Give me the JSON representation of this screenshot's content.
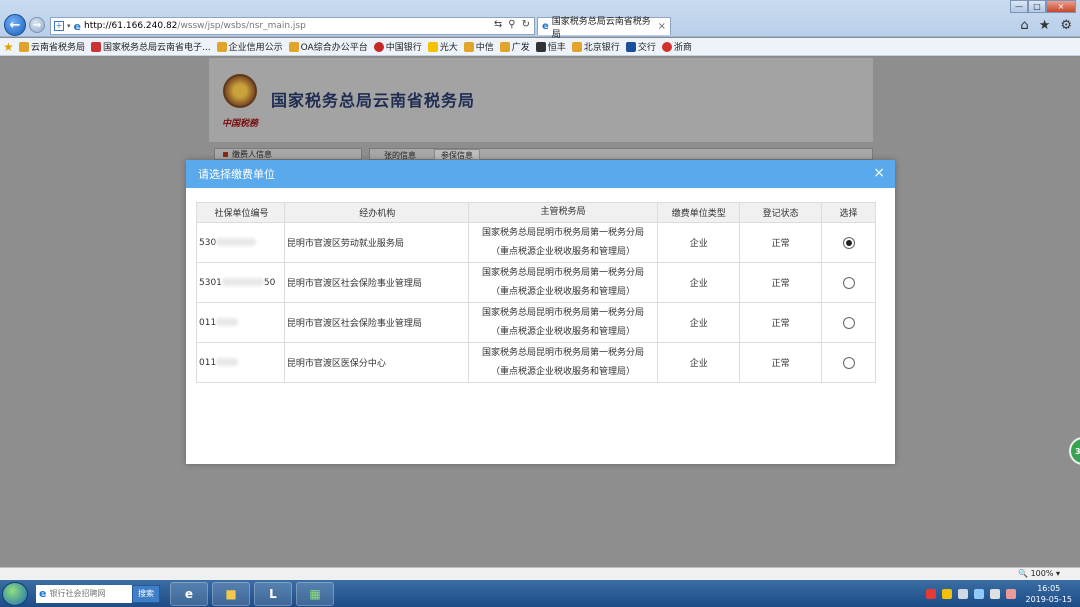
{
  "browser": {
    "address_host": "http://61.166.240.82",
    "address_path": "/wssw/jsp/wsbs/nsr_main.jsp",
    "tab_title": "国家税务总局云南省税务局",
    "zoom_level": "100%"
  },
  "favorites": [
    {
      "label": "云南省税务局",
      "icon_color": "#e0a42a"
    },
    {
      "label": "国家税务总局云南省电子...",
      "icon_color": "#c33"
    },
    {
      "label": "企业信用公示",
      "icon_color": "#e0a42a"
    },
    {
      "label": "OA综合办公平台",
      "icon_color": "#e0a42a"
    },
    {
      "label": "中国银行",
      "icon_color": "#c62828"
    },
    {
      "label": "光大",
      "icon_color": "#f2c200"
    },
    {
      "label": "中信",
      "icon_color": "#e0a42a"
    },
    {
      "label": "广发",
      "icon_color": "#e0a42a"
    },
    {
      "label": "恒丰",
      "icon_color": "#333"
    },
    {
      "label": "北京银行",
      "icon_color": "#e0a42a"
    },
    {
      "label": "交行",
      "icon_color": "#1a4f9c"
    },
    {
      "label": "浙商",
      "icon_color": "#d32f2f"
    }
  ],
  "page": {
    "title": "国家税务总局云南省税务局",
    "slogan": "中国税務",
    "panel_left": "缴费人信息",
    "panel_right_1": "张的信息",
    "panel_right_2": "参保信息",
    "side_badge": "37"
  },
  "modal": {
    "title": "请选择缴费单位",
    "columns": [
      "社保单位编号",
      "经办机构",
      "主管税务局",
      "缴费单位类型",
      "登记状态",
      "选择"
    ],
    "rows": [
      {
        "code_prefix": "530",
        "code_suffix": "",
        "agency": "昆明市官渡区劳动就业服务局",
        "tax_office_line1": "国家税务总局昆明市税务局第一税务分局",
        "tax_office_line2": "（重点税源企业税收服务和管理局）",
        "type": "企业",
        "status": "正常",
        "selected": true
      },
      {
        "code_prefix": "5301",
        "code_suffix": "50",
        "agency": "昆明市官渡区社会保险事业管理局",
        "tax_office_line1": "国家税务总局昆明市税务局第一税务分局",
        "tax_office_line2": "（重点税源企业税收服务和管理局）",
        "type": "企业",
        "status": "正常",
        "selected": false
      },
      {
        "code_prefix": "011",
        "code_suffix": "",
        "agency": "昆明市官渡区社会保险事业管理局",
        "tax_office_line1": "国家税务总局昆明市税务局第一税务分局",
        "tax_office_line2": "（重点税源企业税收服务和管理局）",
        "type": "企业",
        "status": "正常",
        "selected": false
      },
      {
        "code_prefix": "011",
        "code_suffix": "",
        "agency": "昆明市官渡区医保分中心",
        "tax_office_line1": "国家税务总局昆明市税务局第一税务分局",
        "tax_office_line2": "（重点税源企业税收服务和管理局）",
        "type": "企业",
        "status": "正常",
        "selected": false
      }
    ]
  },
  "taskbar": {
    "search_placeholder": "银行社会招聘网",
    "search_button": "搜索",
    "time": "16:05",
    "date": "2019-05-15"
  },
  "colors": {
    "modal_header": "#5aa9ec",
    "taskbar": "#1d4c86"
  }
}
